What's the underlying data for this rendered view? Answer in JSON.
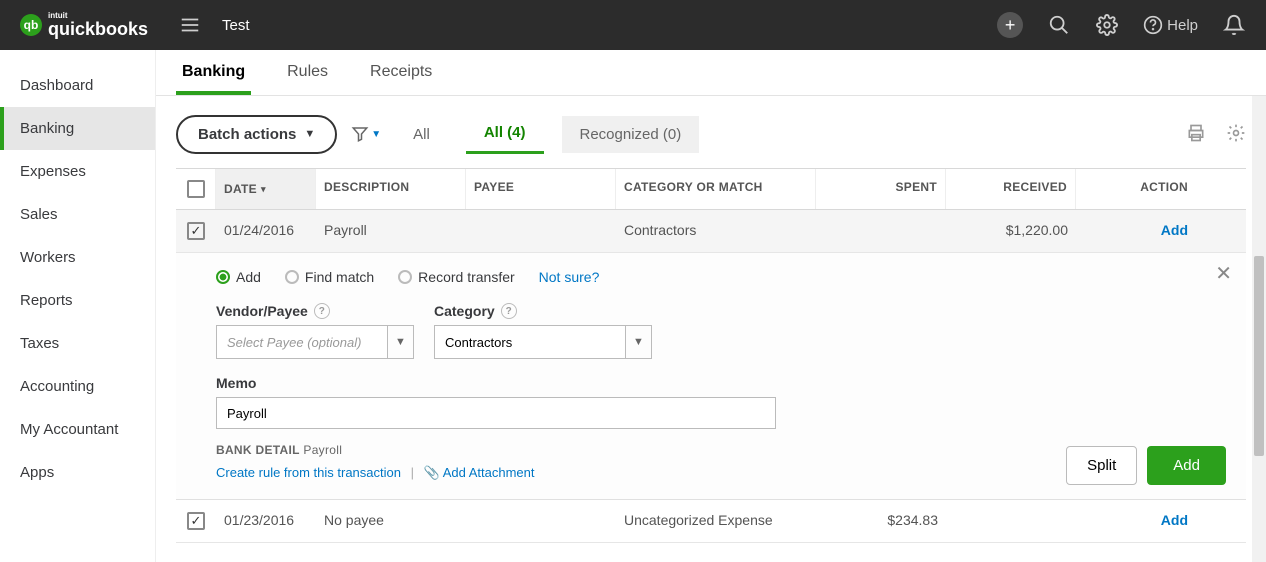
{
  "topbar": {
    "brand_sub": "intuit",
    "brand": "quickbooks",
    "company": "Test",
    "help_label": "Help"
  },
  "sidebar": {
    "items": [
      {
        "label": "Dashboard"
      },
      {
        "label": "Banking"
      },
      {
        "label": "Expenses"
      },
      {
        "label": "Sales"
      },
      {
        "label": "Workers"
      },
      {
        "label": "Reports"
      },
      {
        "label": "Taxes"
      },
      {
        "label": "Accounting"
      },
      {
        "label": "My Accountant"
      },
      {
        "label": "Apps"
      }
    ],
    "active_index": 1
  },
  "subtabs": {
    "items": [
      "Banking",
      "Rules",
      "Receipts"
    ],
    "active_index": 0
  },
  "toolbar": {
    "batch_label": "Batch actions",
    "tabs": {
      "all_label": "All",
      "allcount_label": "All (4)",
      "recognized_label": "Recognized (0)"
    }
  },
  "table": {
    "headers": {
      "date": "DATE",
      "description": "DESCRIPTION",
      "payee": "PAYEE",
      "category": "CATEGORY OR MATCH",
      "spent": "SPENT",
      "received": "RECEIVED",
      "action": "ACTION"
    },
    "rows": [
      {
        "checked": true,
        "date": "01/24/2016",
        "description": "Payroll",
        "payee": "",
        "category": "Contractors",
        "spent": "",
        "received": "$1,220.00",
        "action": "Add"
      },
      {
        "checked": true,
        "date": "01/23/2016",
        "description": "No payee",
        "payee": "",
        "category": "Uncategorized Expense",
        "spent": "$234.83",
        "received": "",
        "action": "Add"
      }
    ]
  },
  "expand": {
    "radios": {
      "add": "Add",
      "find_match": "Find match",
      "record_transfer": "Record transfer"
    },
    "not_sure": "Not sure?",
    "vendor_label": "Vendor/Payee",
    "vendor_placeholder": "Select Payee (optional)",
    "vendor_value": "",
    "category_label": "Category",
    "category_value": "Contractors",
    "memo_label": "Memo",
    "memo_value": "Payroll",
    "bank_detail_label": "BANK DETAIL",
    "bank_detail_value": "Payroll",
    "create_rule": "Create rule from this transaction",
    "add_attachment": "Add Attachment",
    "split_btn": "Split",
    "add_btn": "Add"
  }
}
